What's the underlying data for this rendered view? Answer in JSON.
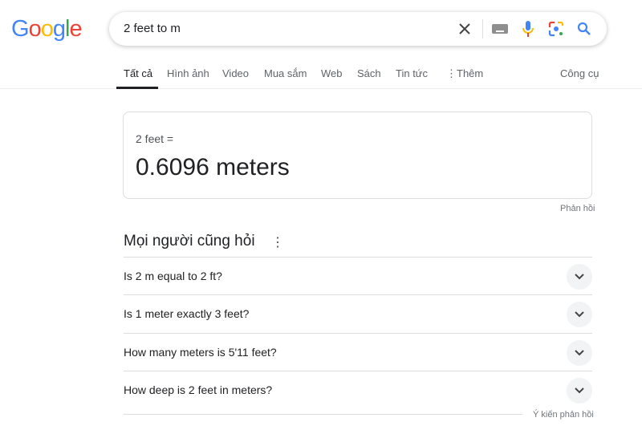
{
  "logo": "Google",
  "search": {
    "query": "2 feet to m"
  },
  "tabs": [
    "Tất cả",
    "Hình ảnh",
    "Video",
    "Mua sắm",
    "Web",
    "Sách",
    "Tin tức",
    "Thêm"
  ],
  "tools": "Công cụ",
  "converter": {
    "label": "2 feet =",
    "value": "0.6096 meters",
    "feedback": "Phản hồi"
  },
  "paa": {
    "title": "Mọi người cũng hỏi",
    "questions": [
      "Is 2 m equal to 2 ft?",
      "Is 1 meter exactly 3 feet?",
      "How many meters is 5'11 feet?",
      "How deep is 2 feet in meters?"
    ],
    "feedback": "Ý kiến phản hồi"
  }
}
